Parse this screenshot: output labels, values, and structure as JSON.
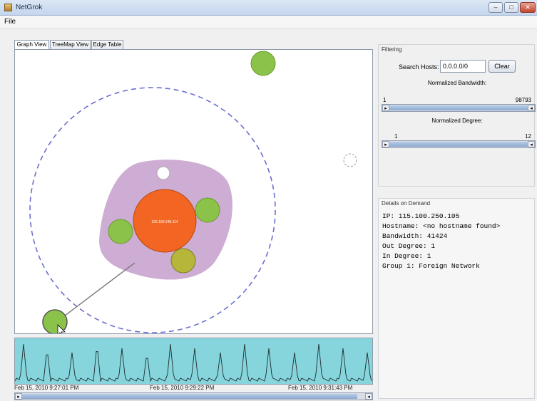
{
  "window": {
    "title": "NetGrok",
    "minimize_glyph": "–",
    "maximize_glyph": "□",
    "close_glyph": "✕"
  },
  "menu": {
    "file": "File"
  },
  "tabs": [
    {
      "label": "Graph View",
      "active": true
    },
    {
      "label": "TreeMap View",
      "active": false
    },
    {
      "label": "Edge Table",
      "active": false
    }
  ],
  "graph": {
    "center_node_label": "192.168.248.114",
    "colors": {
      "group": "#c9a4cf",
      "center": "#f26522",
      "local": "#8bc34a",
      "foreign": "#b6b63a",
      "ring": "#6a6fd0",
      "edge": "#777777"
    }
  },
  "timeline": {
    "labels": [
      "Feb 15, 2010 9:27:01 PM",
      "Feb 15, 2010 9:29:22 PM",
      "Feb 15, 2010 9:31:43 PM"
    ],
    "left_arrow": "▸",
    "right_arrow": "◂"
  },
  "filtering": {
    "title": "Filtering",
    "search_label": "Search Hosts:",
    "search_value": "0.0.0.0/0",
    "clear_label": "Clear",
    "bandwidth_label": "Normalized Bandwidth:",
    "bandwidth_min": "1",
    "bandwidth_max": "98793",
    "degree_label": "Normalized Degree:",
    "degree_min": "1",
    "degree_max": "12",
    "left_arrow": "▸",
    "right_arrow": "◂"
  },
  "details": {
    "title": "Details on Demand",
    "lines": [
      "IP: 115.100.250.105",
      "Hostname: <no hostname found>",
      "Bandwidth: 41424",
      "Out Degree: 1",
      "In Degree: 1",
      "Group 1: Foreign Network"
    ]
  }
}
